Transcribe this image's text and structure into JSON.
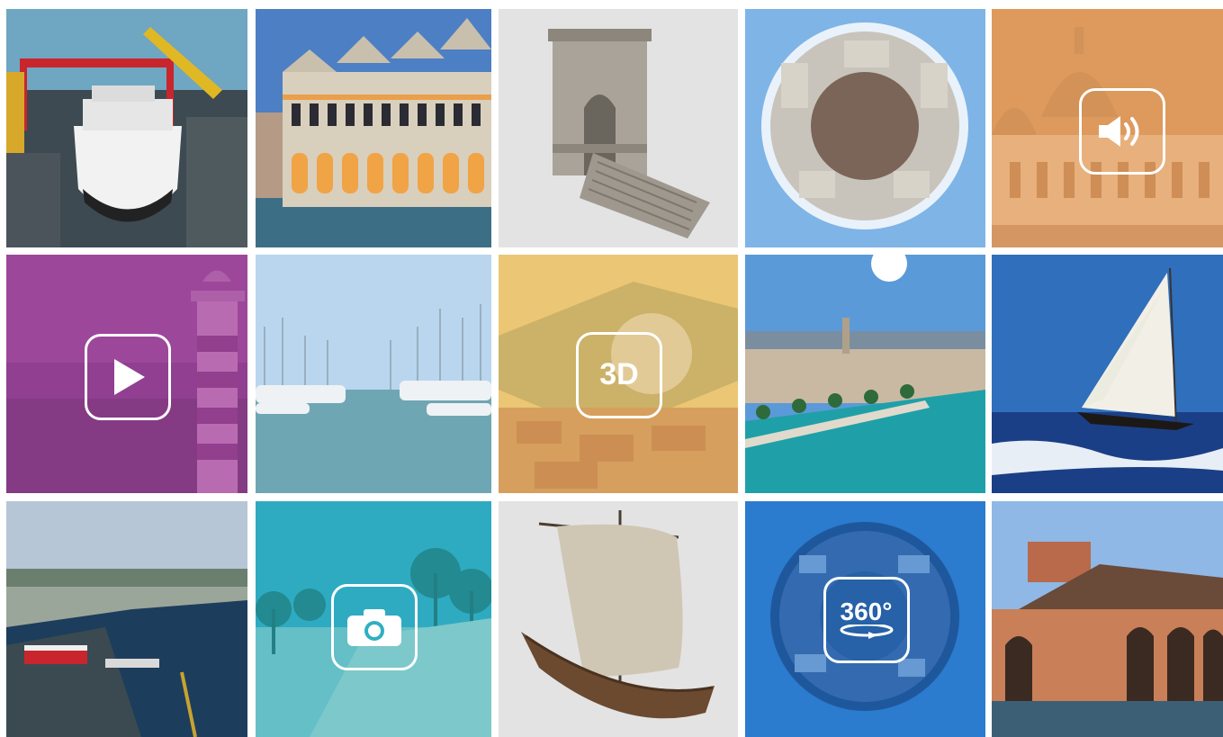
{
  "gallery": {
    "tiles": [
      {
        "subject": "shipyard",
        "icon": null
      },
      {
        "subject": "venetian-palace",
        "icon": null
      },
      {
        "subject": "stone-arch",
        "icon": null
      },
      {
        "subject": "tiny-planet-square",
        "icon": null
      },
      {
        "subject": "domed-church",
        "icon": "speaker-icon",
        "overlay_color": "#e8a060"
      },
      {
        "subject": "lighthouse",
        "icon": "play-icon",
        "overlay_color": "#a23ea0"
      },
      {
        "subject": "marina",
        "icon": null
      },
      {
        "subject": "fortress-aerial",
        "icon": "3d-icon",
        "badge_text": "3D",
        "overlay_color": "#f2c663"
      },
      {
        "subject": "harbor-city",
        "icon": null
      },
      {
        "subject": "sailboat",
        "icon": null
      },
      {
        "subject": "port-aerial",
        "icon": null
      },
      {
        "subject": "palm-promenade",
        "icon": "camera-icon",
        "overlay_color": "#2fb0c0"
      },
      {
        "subject": "sail-ship-model",
        "icon": null
      },
      {
        "subject": "tiny-planet-city",
        "icon": "360-icon",
        "badge_text": "360°",
        "overlay_color": "#1f6fc8"
      },
      {
        "subject": "arsenal-building",
        "icon": null
      }
    ]
  }
}
